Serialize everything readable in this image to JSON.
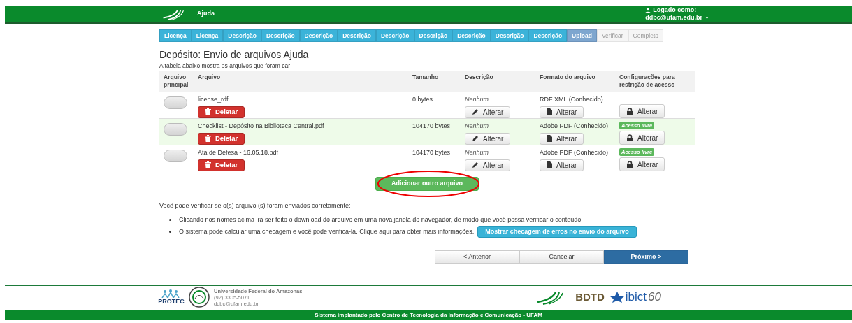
{
  "header": {
    "title": "Ajuda",
    "user_label": "Logado como:",
    "user_email": "ddbc@ufam.edu.br"
  },
  "steps": [
    {
      "label": "Licença",
      "selected": false,
      "disabled": false
    },
    {
      "label": "Licença",
      "selected": false,
      "disabled": false
    },
    {
      "label": "Descrição",
      "selected": false,
      "disabled": false
    },
    {
      "label": "Descrição",
      "selected": false,
      "disabled": false
    },
    {
      "label": "Descrição",
      "selected": false,
      "disabled": false
    },
    {
      "label": "Descrição",
      "selected": false,
      "disabled": false
    },
    {
      "label": "Descrição",
      "selected": false,
      "disabled": false
    },
    {
      "label": "Descrição",
      "selected": false,
      "disabled": false
    },
    {
      "label": "Descrição",
      "selected": false,
      "disabled": false
    },
    {
      "label": "Descrição",
      "selected": false,
      "disabled": false
    },
    {
      "label": "Descrição",
      "selected": false,
      "disabled": false
    },
    {
      "label": "Upload",
      "selected": true,
      "disabled": false
    },
    {
      "label": "Verificar",
      "selected": false,
      "disabled": true
    },
    {
      "label": "Completo",
      "selected": false,
      "disabled": true
    }
  ],
  "heading": "Depósito: Envio de arquivos Ajuda",
  "intro": "A tabela abaixo mostra os arquivos que foram car",
  "table": {
    "columns": [
      "Arquivo principal",
      "Arquivo",
      "Tamanho",
      "Descrição",
      "Formato do arquivo",
      "Configurações para restrição de acesso"
    ],
    "rows": [
      {
        "primary_selected": false,
        "highlighted": false,
        "file": "license_rdf",
        "delete": "Deletar",
        "size": "0 bytes",
        "description": "Nenhum",
        "description_button": "Alterar",
        "format": "RDF XML (Conhecido)",
        "format_button": "Alterar",
        "access_button": "Alterar"
      },
      {
        "primary_selected": false,
        "highlighted": true,
        "file": "Checklist - Depósito na Biblioteca Central.pdf",
        "delete": "Deletar",
        "size": "104170 bytes",
        "description": "Nenhum",
        "description_button": "Alterar",
        "format": "Adobe PDF (Conhecido)",
        "format_button": "Alterar",
        "access_badge": "Acesso livre",
        "access_button": "Alterar"
      },
      {
        "primary_selected": false,
        "highlighted": false,
        "file": "Ata de Defesa - 16.05.18.pdf",
        "delete": "Deletar",
        "size": "104170 bytes",
        "description": "Nenhum",
        "description_button": "Alterar",
        "format": "Adobe PDF (Conhecido)",
        "format_button": "Alterar",
        "access_badge": "Acesso livre",
        "access_button": "Alterar"
      }
    ]
  },
  "add_button": "Adicionar outro arquivo",
  "verify_note": "Você pode verificar se o(s) arquivo (s) foram enviados corretamente:",
  "bullets": [
    {
      "text": "Clicando nos nomes acima irá ser feito o download do arquivo em uma nova janela do navegador, de modo que você possa verificar o conteúdo."
    },
    {
      "text": "O sistema pode calcular uma checagem e você pode verifica-la. Clique aqui para obter mais informações.",
      "button": "Mostrar checagem de erros no envio do arquivo"
    }
  ],
  "nav": [
    {
      "label": "< Anterior",
      "kind": "default"
    },
    {
      "label": "Cancelar",
      "kind": "default"
    },
    {
      "label": "Próximo >",
      "kind": "primary"
    }
  ],
  "footer": {
    "protec": "PROTEC",
    "institution": "Universidade Federal do Amazonas",
    "phone": "(92) 3305-5071",
    "email": "ddbc@ufam.edu.br",
    "bdtd": "BDTD",
    "ibict": "ibict",
    "sixty": "60",
    "bottom": "Sistema implantado pelo Centro de Tecnologia da Informação e Comunicação - UFAM"
  }
}
